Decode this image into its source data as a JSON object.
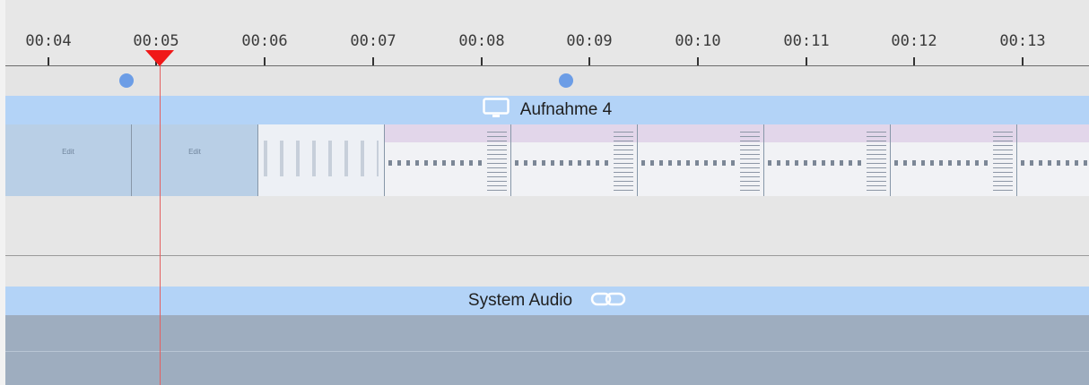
{
  "ruler": {
    "ticks": [
      {
        "label": "00:04",
        "pos": 54
      },
      {
        "label": "00:05",
        "pos": 174
      },
      {
        "label": "00:06",
        "pos": 295
      },
      {
        "label": "00:07",
        "pos": 416
      },
      {
        "label": "00:08",
        "pos": 537
      },
      {
        "label": "00:09",
        "pos": 657
      },
      {
        "label": "00:10",
        "pos": 778
      },
      {
        "label": "00:11",
        "pos": 899
      },
      {
        "label": "00:12",
        "pos": 1019
      },
      {
        "label": "00:13",
        "pos": 1140
      }
    ]
  },
  "video_track": {
    "title": "Aufnahme 4",
    "icon": "display-icon",
    "thumbnails": [
      "edit",
      "edit",
      "light",
      "dense",
      "dense",
      "dense",
      "dense",
      "dense",
      "dense"
    ],
    "edit_label": "Edit"
  },
  "audio_track": {
    "title": "System Audio",
    "icon": "link-icon"
  },
  "colors": {
    "track_header": "#b3d3f7",
    "playhead": "#f01818",
    "marker": "#6c9de6",
    "audio_body": "#9eadbf"
  }
}
